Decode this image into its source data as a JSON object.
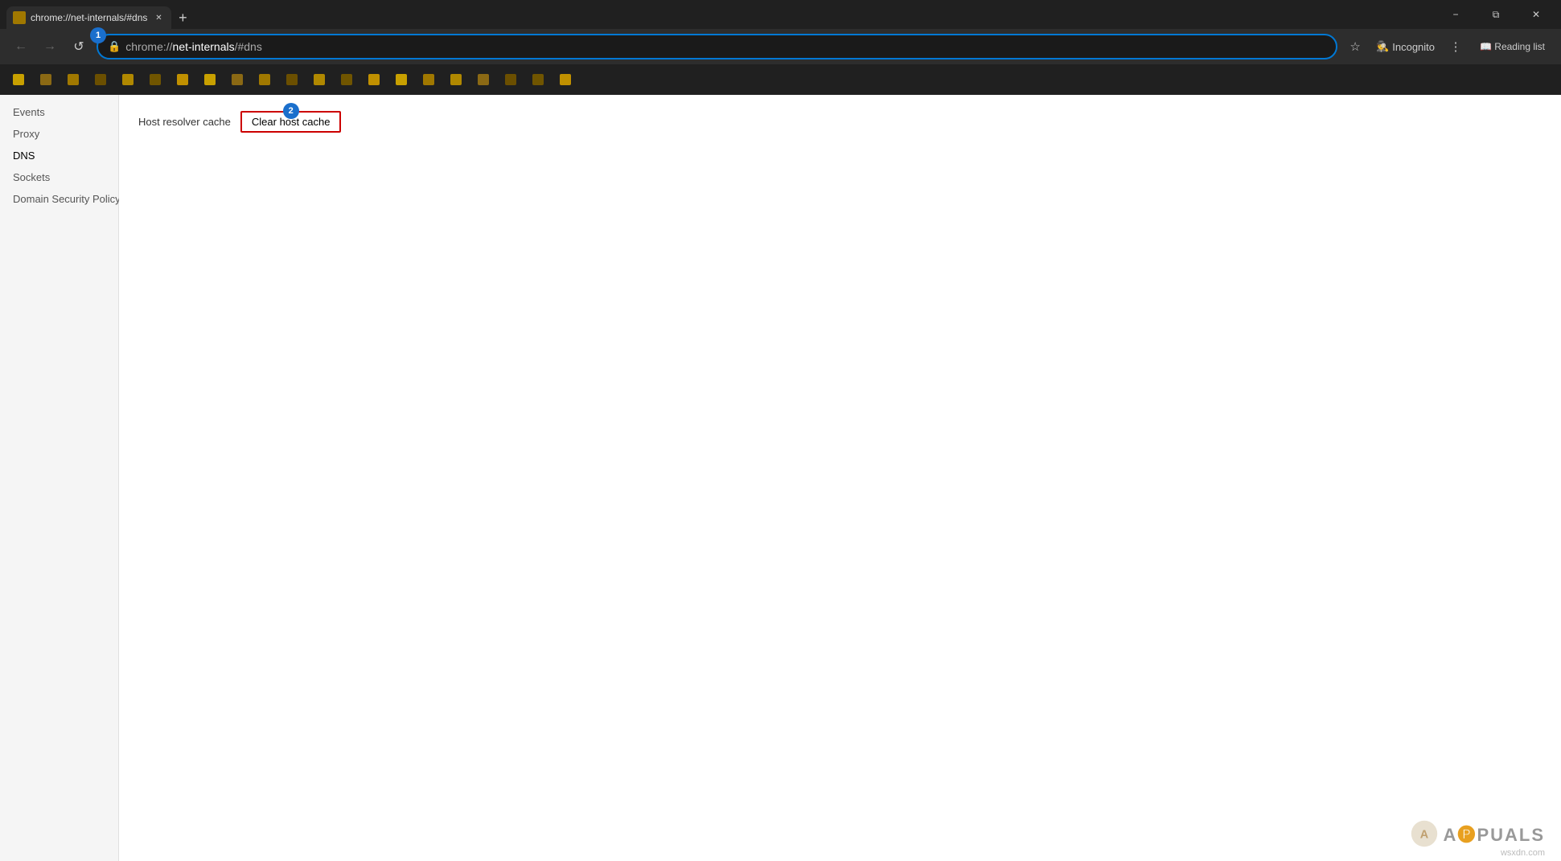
{
  "titlebar": {
    "tab_title": "chrome://net-internals/#dns",
    "tab_favicon_alt": "chrome",
    "new_tab_label": "+",
    "window_minimize": "−",
    "window_restore": "⧉",
    "window_close": "✕"
  },
  "addressbar": {
    "back_btn": "←",
    "forward_btn": "→",
    "refresh_btn": "↺",
    "url": "chrome://net-internals/#dns",
    "url_prefix": "chrome://",
    "url_main": "net-internals",
    "url_hash": "/#dns",
    "star_btn": "☆",
    "incognito_label": "Incognito",
    "menu_btn": "⋮",
    "reading_list": "📖 Reading list",
    "badge1_label": "1"
  },
  "bookmarks": {
    "items": [
      {
        "label": ""
      },
      {
        "label": ""
      },
      {
        "label": ""
      },
      {
        "label": ""
      },
      {
        "label": ""
      },
      {
        "label": ""
      },
      {
        "label": ""
      },
      {
        "label": ""
      },
      {
        "label": ""
      },
      {
        "label": ""
      },
      {
        "label": ""
      },
      {
        "label": ""
      },
      {
        "label": ""
      },
      {
        "label": ""
      },
      {
        "label": ""
      },
      {
        "label": ""
      },
      {
        "label": ""
      },
      {
        "label": ""
      },
      {
        "label": ""
      },
      {
        "label": ""
      },
      {
        "label": ""
      }
    ]
  },
  "sidebar": {
    "items": [
      {
        "label": "Events",
        "id": "events",
        "active": false
      },
      {
        "label": "Proxy",
        "id": "proxy",
        "active": false
      },
      {
        "label": "DNS",
        "id": "dns",
        "active": true
      },
      {
        "label": "Sockets",
        "id": "sockets",
        "active": false
      },
      {
        "label": "Domain Security Policy",
        "id": "domain-security-policy",
        "active": false
      }
    ]
  },
  "content": {
    "host_resolver_label": "Host resolver cache",
    "clear_cache_btn_label": "Clear host cache",
    "badge2_label": "2"
  },
  "watermark": {
    "text": "A🅿PUALS",
    "domain": "wsxdn.com"
  }
}
